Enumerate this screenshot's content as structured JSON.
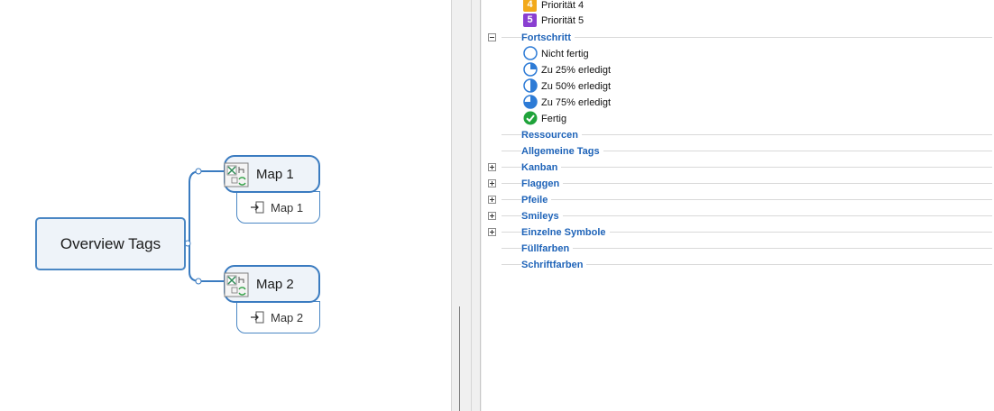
{
  "mindmap": {
    "central_topic": "Overview Tags",
    "topics": [
      {
        "label": "Map 1",
        "sub_label": "Map 1"
      },
      {
        "label": "Map 2",
        "sub_label": "Map 2"
      }
    ]
  },
  "tags_panel": {
    "priority_items": [
      {
        "badge": "4",
        "label": "Priorität 4",
        "color": "#f2a91a"
      },
      {
        "badge": "5",
        "label": "Priorität 5",
        "color": "#8a3fd1"
      }
    ],
    "progress": {
      "label": "Fortschritt",
      "expanded": true,
      "items": [
        {
          "label": "Nicht fertig",
          "icon": "progress-0-icon"
        },
        {
          "label": "Zu 25% erledigt",
          "icon": "progress-25-icon"
        },
        {
          "label": "Zu 50% erledigt",
          "icon": "progress-50-icon"
        },
        {
          "label": "Zu 75% erledigt",
          "icon": "progress-75-icon"
        },
        {
          "label": "Fertig",
          "icon": "check-circle-icon"
        }
      ]
    },
    "categories": [
      {
        "label": "Ressourcen"
      },
      {
        "label": "Allgemeine Tags"
      },
      {
        "label": "Kanban",
        "expandable": true
      },
      {
        "label": "Flaggen",
        "expandable": true
      },
      {
        "label": "Pfeile",
        "expandable": true
      },
      {
        "label": "Smileys",
        "expandable": true
      },
      {
        "label": "Einzelne Symbole",
        "expandable": true
      },
      {
        "label": "Füllfarben"
      },
      {
        "label": "Schriftfarben"
      }
    ],
    "colors": {
      "category_text": "#1e63b8",
      "progress_fill": "#2d7bd6",
      "check_fill": "#1fa33a"
    }
  }
}
